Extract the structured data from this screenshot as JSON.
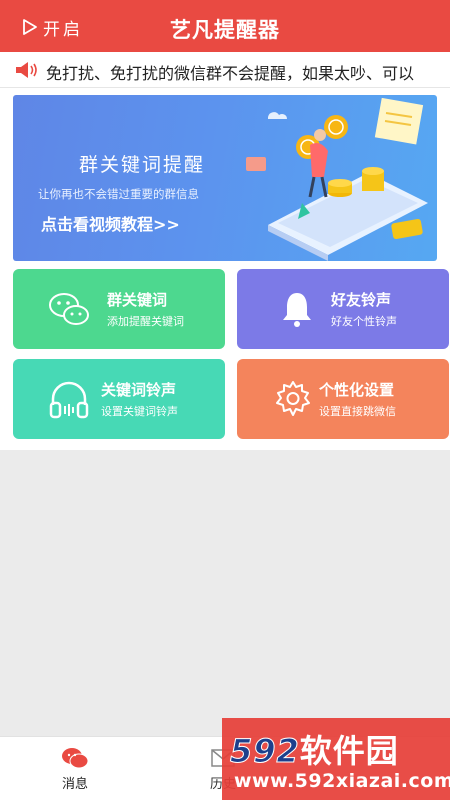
{
  "header": {
    "start_label": "开启",
    "title": "艺凡提醒器"
  },
  "notice": {
    "text": "免打扰、免打扰的微信群不会提醒，如果太吵、可以"
  },
  "banner": {
    "title": "群关键词提醒",
    "subtitle": "让你再也不会错过重要的群信息",
    "cta": "点击看视频教程>>"
  },
  "cards": [
    {
      "title": "群关键词",
      "subtitle": "添加提醒关键词",
      "icon": "wechat-icon",
      "color": "#4dd88f"
    },
    {
      "title": "好友铃声",
      "subtitle": "好友个性铃声",
      "icon": "bell-icon",
      "color": "#7c7ae7"
    },
    {
      "title": "关键词铃声",
      "subtitle": "设置关键词铃声",
      "icon": "headphones-icon",
      "color": "#47d9b5"
    },
    {
      "title": "个性化设置",
      "subtitle": "设置直接跳微信",
      "icon": "gear-icon",
      "color": "#f4845c"
    }
  ],
  "nav": {
    "items": [
      {
        "label": "消息",
        "icon": "chat-icon"
      },
      {
        "label": "历史",
        "icon": "mail-icon"
      }
    ]
  },
  "watermark": {
    "number": "592",
    "text": "软件园",
    "url": "www.592xiazai.com"
  },
  "colors": {
    "header": "#e94a42",
    "banner": "#5c93ee"
  }
}
